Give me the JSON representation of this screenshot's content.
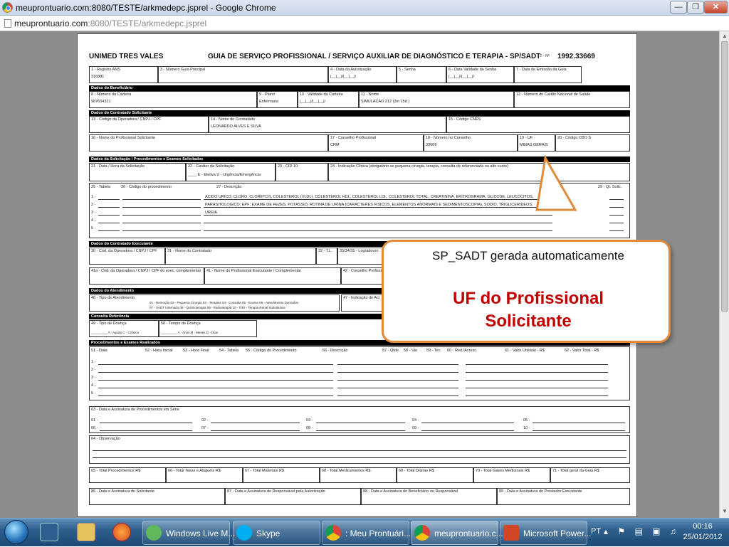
{
  "window": {
    "title": "meuprontuario.com:8080/TESTE/arkmedepc.jsprel - Google Chrome"
  },
  "address": {
    "host": "meuprontuario.com",
    "path": ":8080/TESTE/arkmedepc.jsprel"
  },
  "form": {
    "operator": "UNIMED TRES VALES",
    "title": "GUIA DE SERVIÇO PROFISSIONAL / SERVIÇO AUXILIAR DE DIAGNÓSTICO E TERAPIA - SP/SADT",
    "no_label": "2 - Nº",
    "no_value": "1992.33669",
    "f1_label": "1 - Registro ANS",
    "f1_value": "316881",
    "f3_label": "3 - Número Guia Principal",
    "f4_label": "4 - Data da Autorização",
    "f4_value": "|__|__|/|__|__|/",
    "f5_label": "5 - Senha",
    "f6_label": "6 - Data Validade da Senha",
    "f6_value": "|__|__|/|__|__|/",
    "f7_label": "7 - Data de Emissão da Guia",
    "sec_beneficiario": "Dados do Beneficiário",
    "f8_label": "8 - Número da Carteira",
    "f8_value": "987654321",
    "f9_label": "9 - Plano",
    "f9_value": "Enfermaria",
    "f10_label": "10 - Validade da Carteira",
    "f10_value": "|__|__|/|__|__|/",
    "f11_label": "11 - Nome",
    "f11_value": "SIMULACAO 212 (3m 15d )",
    "f12_label": "12 - Número do Cartão Nacional de Saúde",
    "sec_solicitante": "Dados do Contratado Solicitante",
    "f13_label": "13 - Código da Operadora / CNPJ / CPF",
    "f14_label": "14 - Nome do Contratado",
    "f14_value": "LEONARDO ALVES E SILVA",
    "f15_label": "15 - Código CNES",
    "f16_label": "16 - Nome do Profissional Solicitante",
    "f17_label": "17 - Conselho Profissional",
    "f17_value": "CRM",
    "f18_label": "18 - Número no Conselho",
    "f18_value": "33669",
    "f19_label": "19 - UF",
    "f19_value": "MINAS GERAIS",
    "f20_label": "20 - Código CBO S",
    "sec_solicitacao": "Dados da Solicitação / Procedimentos e Exames Solicitados",
    "f21_label": "21 - Data / Hora da Solicitação",
    "f22_label": "22 - Caráter da Solicitação",
    "f22_value": "____ E - Eletiva  U - Urgência/Emergência",
    "f23_label": "23 - CID 10",
    "f24_label": "24 - Indicação Clínica (obrigatório se pequena cirurgia, terapia, consulta de referenciada ou alto custo)",
    "f25_label": "25 - Tabela",
    "f26_label": "26 - Código do procedimento",
    "f27_label": "27 - Descrição",
    "f28_label": "28 - Qt. Solic.",
    "f29_label": "29 - Qt. Solic.",
    "proc_lines": [
      "ACIDO URICO, CLORO, CLORETOS, COLESTEROL (VLDL), COLESTEROL HDL, COLESTEROL LDL, COLESTEROL TOTAL, CREATININA, ERITROGRAMA, GLICOSE, LEUCÓCITOS,",
      "PARASITOLOGICO; EPF; EXAME DE FEZES, POTASSIO, ROTINA DE URINA (CARACTERES FISICOS, ELEMENTOS ANORMAIS E SEDIMENTOSCOPIA), SODIO, TRIGLICERIDEOS,",
      "UREIA"
    ],
    "row_nums": [
      "1 -",
      "2 -",
      "3 -",
      "4 -",
      "5 -"
    ],
    "sec_executante": "Dados do Contratado Executante",
    "f30_label": "30 - Cód. da Operadora / CNPJ / CPF",
    "f31_label": "31 - Nome do Contratado",
    "f32_label": "32 - T.L.",
    "f33_label": "33/34/35 - Logradouro",
    "f41a_label": "41a - Cód. da Operadora / CNPJ / CPF do exec. complementar",
    "f41_label": "41 - Nome do Profissional Executante / Complementar",
    "f42_label": "42 - Conselho Profissional",
    "sec_atendimento": "Dados do Atendimento",
    "f46_label": "46 - Tipo de Atendimento",
    "f46_opts1": "01 - Remoção  02 - Pequena Cirurgia  03 - Terapias  04 - Consulta  05 - Exame  06 - Atendimento Domiciliar",
    "f46_opts2": "07 - SADT Internado  08 - Quimioterapia  09 - Radioterapia  10 - TRS - Terapia Renal Substitutiva",
    "f47_label": "47 - Indicação de Aci",
    "sec_consulta": "Consulta Referência",
    "f49_label": "49 - Tipo de Doença",
    "f49_opts": "_________  A - Aguda  C - Crônica",
    "f50_label": "50 - Tempo de Doença",
    "f50_opts": "_________ A - Anos  M - Meses  D - Dias",
    "sec_realizados": "Procedimentos e Exames Realizados",
    "real_headers": [
      "51 - Data",
      "52 - Hora Inicial",
      "53 - Hora Final",
      "54 - Tabela",
      "55 - Código do Procedimento",
      "56 - Descrição",
      "57 - Qtde.",
      "58 - Via",
      "59 - Tec.",
      "60 - Red./Acresc.",
      "61 - Valor Unitário - R$",
      "62 - Valor Total - R$"
    ],
    "f63_label": "63 - Data e Assinatura de Procedimentos em Série",
    "serie": [
      "01 -",
      "02 -",
      "03 -",
      "04 -",
      "05 -",
      "06 -",
      "07 -",
      "08 -",
      "09 -",
      "10 -"
    ],
    "f64_label": "64 - Observação",
    "totals": [
      "65 - Total Procedimentos R$",
      "66 - Total Taxas e Aluguéis R$",
      "67 - Total Materiais R$",
      "68 - Total Medicamentos R$",
      "69 - Total Diárias R$",
      "70 - Total Gases Medicinais R$",
      "71 - Total geral da Guia R$"
    ],
    "signatures": [
      "86 - Data e Assinatura do Solicitante",
      "87 - Data e Assinatura do Responsável pela Autorização",
      "88 - Data e Assinatura do Beneficiário ou Responsável",
      "89 - Data e Assinatura do Prestador Executante"
    ]
  },
  "callout": {
    "line1": "SP_SADT gerada automaticamente",
    "line2": "UF do Profissional",
    "line3": "Solicitante",
    "border_color": "#e08a3c",
    "highlight_color": "#c00000"
  },
  "taskbar": {
    "items": [
      {
        "label": "Windows Live M...",
        "icon": "messenger-icon"
      },
      {
        "label": "Skype",
        "icon": "skype-icon"
      },
      {
        "label": ": Meu Prontuári...",
        "icon": "chrome-icon"
      },
      {
        "label": "meuprontuario.c...",
        "icon": "chrome-icon"
      },
      {
        "label": "Microsoft Power...",
        "icon": "powerpoint-icon"
      }
    ],
    "lang": "PT",
    "time": "00:16",
    "date": "25/01/2012"
  }
}
